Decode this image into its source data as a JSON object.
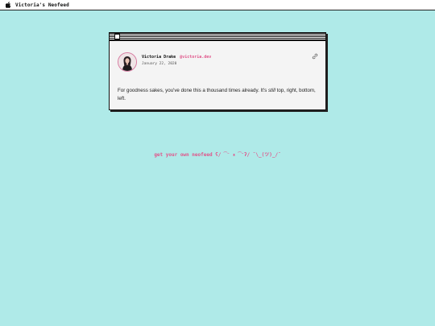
{
  "menubar": {
    "apple_icon": "apple-icon",
    "title": "Victoria's Neofeed"
  },
  "post": {
    "author_name": "Victoria Drake",
    "author_handle": "@victoria.dev",
    "date": "January 22, 2020",
    "link_icon": "link-icon",
    "body_before": "For goodness sakes, you've done this a thousand times already. It's ",
    "body_emphasis": "still",
    "body_after": " top, right, bottom, left."
  },
  "footer": {
    "link_text": "get your own neofeed ʕ/ ͡ᵔ ᴥ ͡ᵔʔ/ ¯\\_(ツ)_/¯"
  },
  "colors": {
    "background": "#afeae8",
    "accent": "#e0558a",
    "window": "#f4f4f4"
  }
}
